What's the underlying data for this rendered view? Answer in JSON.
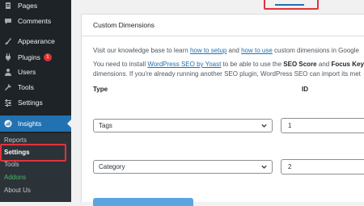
{
  "sidebar": {
    "items": [
      {
        "label": "Pages",
        "icon": "pages-icon"
      },
      {
        "label": "Comments",
        "icon": "comments-icon"
      },
      {
        "label": "Appearance",
        "icon": "appearance-icon"
      },
      {
        "label": "Plugins",
        "icon": "plugins-icon",
        "badge": "1"
      },
      {
        "label": "Users",
        "icon": "users-icon"
      },
      {
        "label": "Tools",
        "icon": "tools-icon"
      },
      {
        "label": "Settings",
        "icon": "settings-icon"
      },
      {
        "label": "Insights",
        "icon": "insights-icon",
        "active": true
      }
    ],
    "submenu": [
      "Reports",
      "Settings",
      "Tools",
      "Addons",
      "About Us"
    ]
  },
  "panel": {
    "title": "Custom Dimensions",
    "line1": {
      "pre": "Visit our knowledge base to learn ",
      "link1": "how to setup",
      "mid": " and ",
      "link2": "how to use",
      "post": " custom dimensions in Google"
    },
    "line2": {
      "pre": "You need to install ",
      "link": "WordPress SEO by Yoast",
      "mid": " to be able to use the ",
      "bold1": "SEO Score",
      "and": " and ",
      "bold2": "Focus Key"
    },
    "line3": "dimensions. If you're already running another SEO plugin, WordPress SEO can import its met",
    "col_type": "Type",
    "col_id": "ID",
    "rows": [
      {
        "type": "Tags",
        "id": "1"
      },
      {
        "type": "Category",
        "id": "2"
      }
    ]
  },
  "colors": {
    "sidebar_bg": "#1d2327",
    "active_bg": "#2271b1",
    "link": "#2271b1",
    "highlight": "#e2323f",
    "addons": "#4ab866",
    "badge": "#d63638"
  }
}
